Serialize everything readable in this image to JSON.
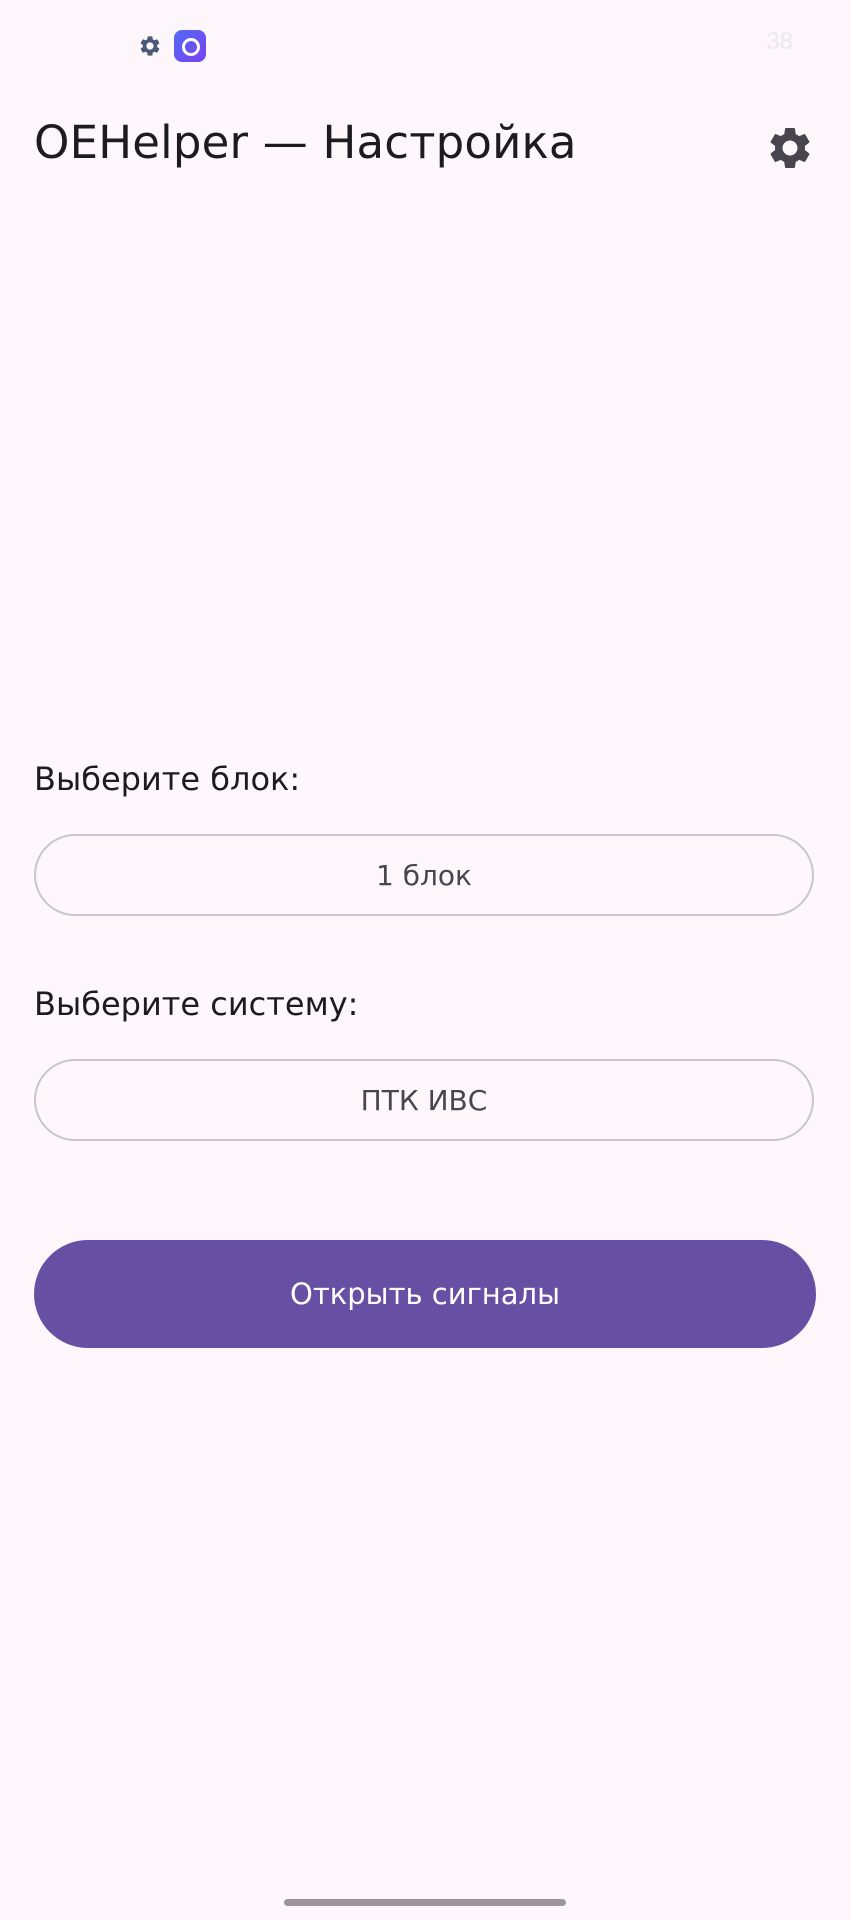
{
  "status_bar": {
    "battery_text": "38",
    "icons": [
      "gear-icon",
      "app-icon"
    ]
  },
  "app_bar": {
    "title": "OEHelper — Настройка",
    "settings_icon": "gear-icon"
  },
  "block_select": {
    "label": "Выберите блок:",
    "value": "1 блок"
  },
  "system_select": {
    "label": "Выберите систему:",
    "value": "ПТК ИВС"
  },
  "actions": {
    "open_signals_label": "Открыть сигналы"
  },
  "colors": {
    "background": "#fdf7fb",
    "primary": "#6750a4",
    "outline": "#cac4cf",
    "text": "#1d1b20"
  }
}
